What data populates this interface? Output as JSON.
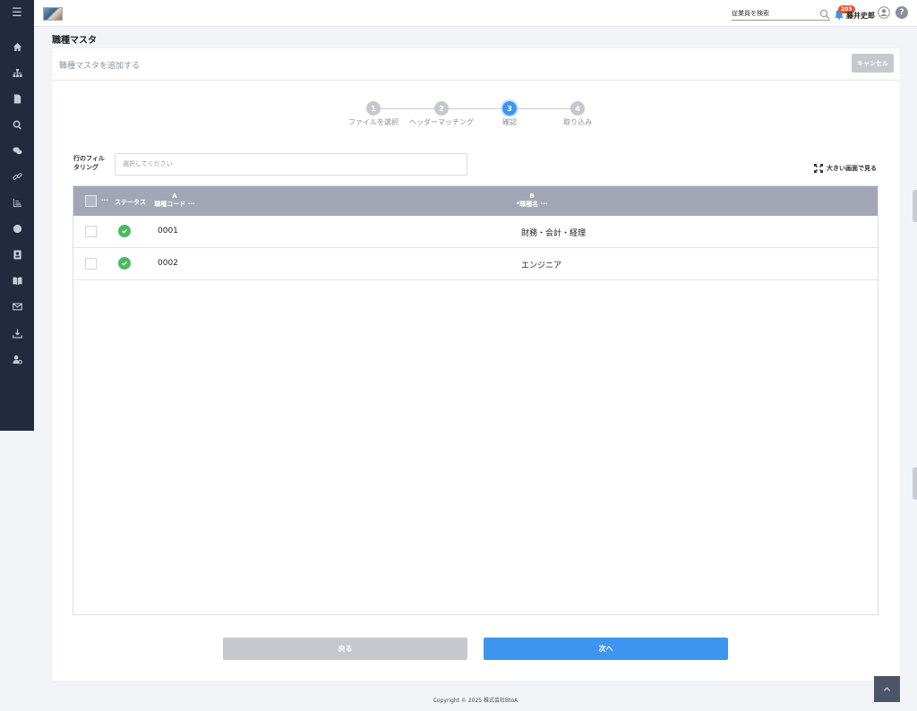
{
  "header": {
    "search_placeholder": "従業員を検索",
    "notification_count": "205",
    "user_name": "藤井史郎",
    "help_label": "?"
  },
  "sidebar": {
    "icons": [
      "menu-icon",
      "home-icon",
      "org-chart-icon",
      "document-icon",
      "search-icon",
      "chat-icon",
      "link-icon",
      "chart-icon",
      "globe-icon",
      "contact-card-icon",
      "book-icon",
      "mail-icon",
      "download-icon",
      "user-settings-icon"
    ]
  },
  "page": {
    "title": "職種マスタ"
  },
  "card": {
    "title": "職種マスタを追加する",
    "cancel_label": "キャンセル"
  },
  "steps": [
    {
      "number": "1",
      "label": "ファイルを選択",
      "active": false
    },
    {
      "number": "2",
      "label": "ヘッダーマッチング",
      "active": false
    },
    {
      "number": "3",
      "label": "確認",
      "active": true
    },
    {
      "number": "4",
      "label": "取り込み",
      "active": false
    }
  ],
  "filter": {
    "label": "行のフィルタリング",
    "placeholder": "選択してください",
    "fullscreen_label": "大きい画面で見る"
  },
  "table": {
    "menu_dots": "···",
    "status_header": "ステータス",
    "col_a_letter": "A",
    "col_a_name": "職種コード",
    "col_b_letter": "B",
    "col_b_name": "*職種名",
    "rows": [
      {
        "code": "0001",
        "name": "財務・会計・経理"
      },
      {
        "code": "0002",
        "name": "エンジニア"
      }
    ]
  },
  "footer": {
    "back_label": "戻る",
    "next_label": "次へ",
    "copyright": "Copyright © 2025 株式会社BtoA"
  },
  "colors": {
    "sidebar": "#232a3e",
    "primary": "#3d95f0",
    "disabled": "#c6c8ce",
    "table_header": "#a3a7b5",
    "status_ok": "#4cb961",
    "badge": "#e8542b"
  }
}
